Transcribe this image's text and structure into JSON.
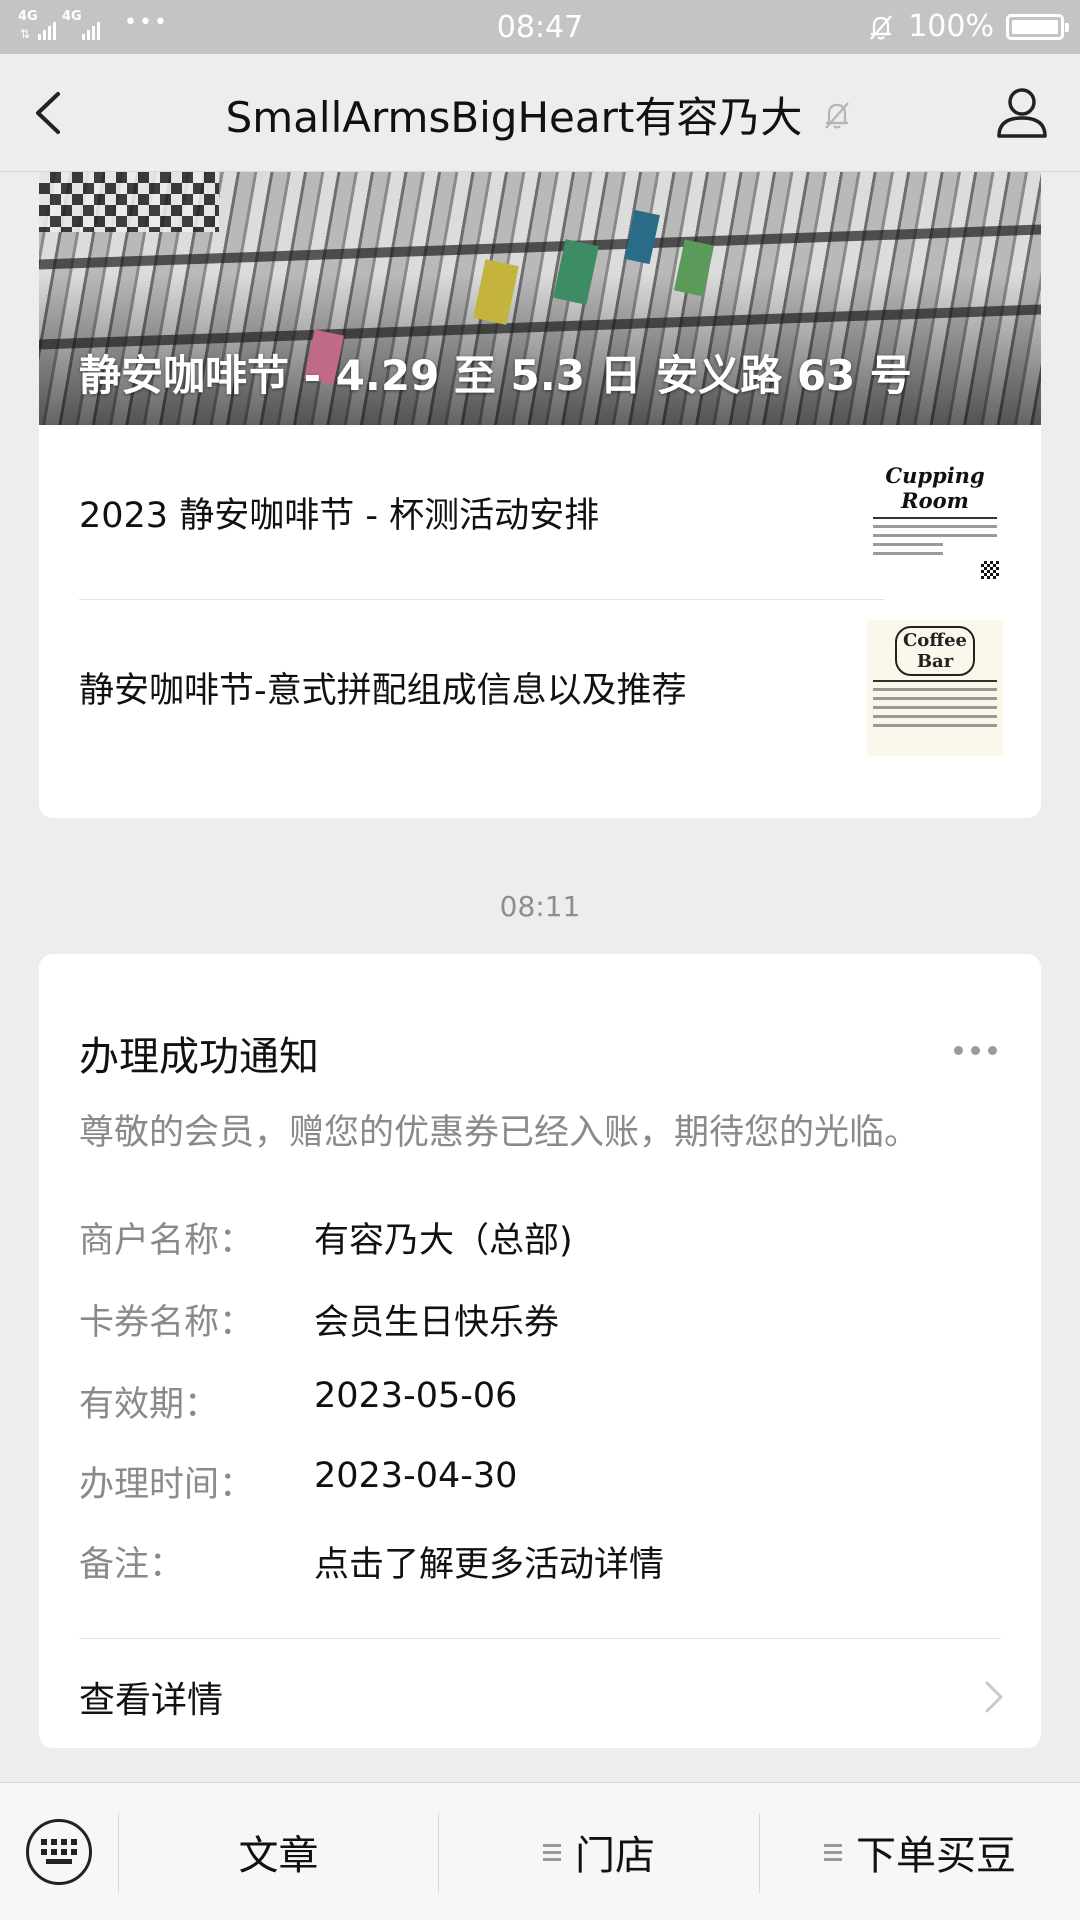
{
  "status_bar": {
    "network_label": "4G",
    "network2_label": "4G",
    "dots": "•••",
    "time": "08:47",
    "battery_percent": "100%",
    "battery_level": 1.0
  },
  "nav": {
    "title": "SmallArmsBigHeart有容乃大",
    "back_icon": "chevron-left-icon",
    "mute_icon": "bell-muted-icon",
    "profile_icon": "user-icon"
  },
  "article_card": {
    "cover_title": "静安咖啡节 - 4.29 至 5.3 日 安义路 63 号",
    "items": [
      {
        "title": "2023 静安咖啡节 - 杯测活动安排",
        "thumb_heading": "Cupping Room"
      },
      {
        "title": "静安咖啡节-意式拼配组成信息以及推荐",
        "thumb_heading": "Coffee Bar"
      }
    ]
  },
  "timestamp": "08:11",
  "notice": {
    "title": "办理成功通知",
    "description": "尊敬的会员，赠您的优惠券已经入账，期待您的光临。",
    "fields": [
      {
        "label": "商户名称：",
        "value": "有容乃大（总部)"
      },
      {
        "label": "卡券名称：",
        "value": "会员生日快乐券"
      },
      {
        "label": "有效期：",
        "value": "2023-05-06"
      },
      {
        "label": "办理时间：",
        "value": "2023-04-30"
      },
      {
        "label": "备注：",
        "value": "点击了解更多活动详情"
      }
    ],
    "detail_label": "查看详情"
  },
  "bottom_menu": {
    "keyboard_icon": "keyboard-icon",
    "items": [
      {
        "label": "文章",
        "has_submenu": false
      },
      {
        "label": "门店",
        "has_submenu": true
      },
      {
        "label": "下单买豆",
        "has_submenu": true
      }
    ]
  }
}
